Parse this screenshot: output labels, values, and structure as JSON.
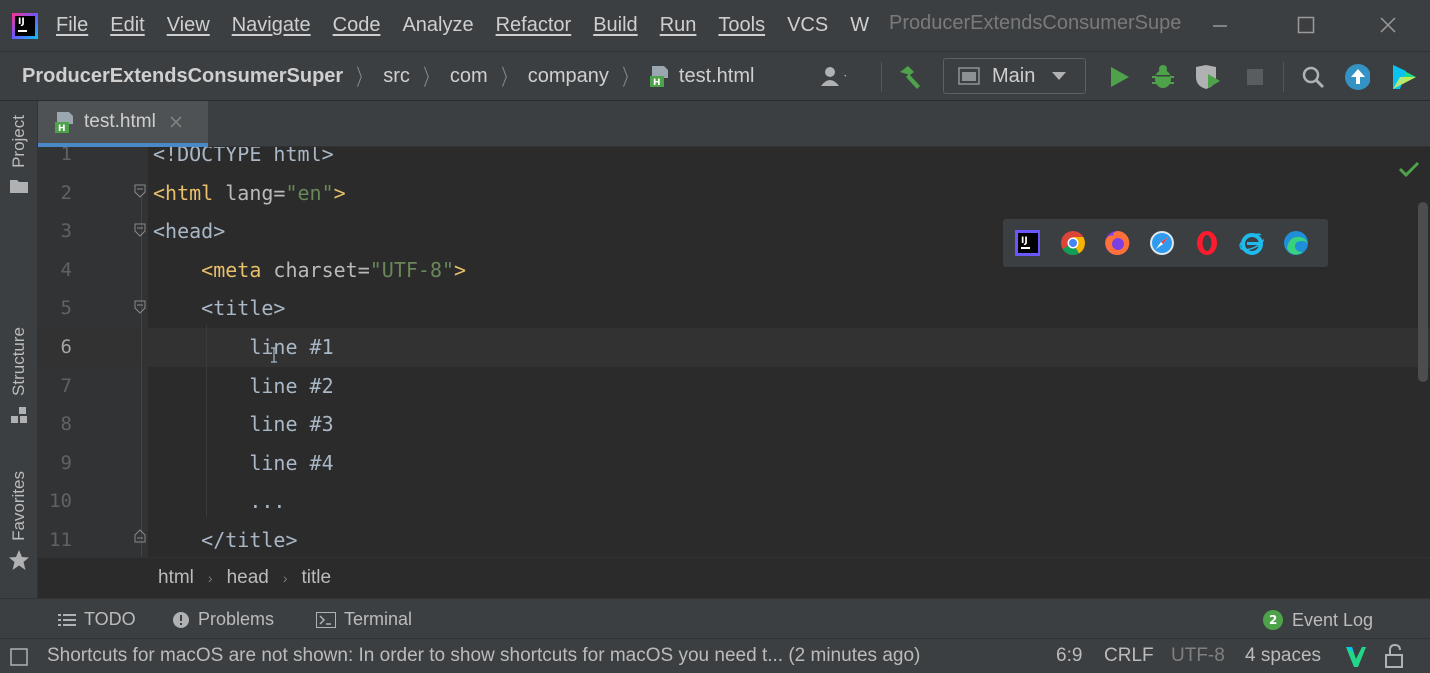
{
  "menu": {
    "app_logo_text": "IJ",
    "items": [
      "File",
      "Edit",
      "View",
      "Navigate",
      "Code",
      "Analyze",
      "Refactor",
      "Build",
      "Run",
      "Tools",
      "VCS",
      "W"
    ],
    "window_title": "ProducerExtendsConsumerSuper"
  },
  "navbar": {
    "crumbs": [
      "ProducerExtendsConsumerSuper",
      "src",
      "com",
      "company",
      "test.html"
    ],
    "run_config": "Main"
  },
  "left_strip": {
    "tabs": [
      "Project",
      "Structure",
      "Favorites"
    ]
  },
  "editor_tabs": [
    {
      "label": "test.html",
      "active": true
    }
  ],
  "editor": {
    "lines": [
      {
        "num": "1",
        "text": "<!DOCTYPE html>"
      },
      {
        "num": "2",
        "text": "<html lang=\"en\">"
      },
      {
        "num": "3",
        "text": "<head>"
      },
      {
        "num": "4",
        "text": "    <meta charset=\"UTF-8\">"
      },
      {
        "num": "5",
        "text": "    <title>"
      },
      {
        "num": "6",
        "text": "        line #1"
      },
      {
        "num": "7",
        "text": "        line #2"
      },
      {
        "num": "8",
        "text": "        line #3"
      },
      {
        "num": "9",
        "text": "        line #4"
      },
      {
        "num": "10",
        "text": "        ..."
      },
      {
        "num": "11",
        "text": "    </title>"
      }
    ],
    "browsers": [
      "intellij-icon",
      "chrome-icon",
      "firefox-icon",
      "safari-icon",
      "opera-icon",
      "ie-icon",
      "edge-icon"
    ]
  },
  "breadcrumb_bar": [
    "html",
    "head",
    "title"
  ],
  "tool_windows": {
    "todo": "TODO",
    "problems": "Problems",
    "terminal": "Terminal",
    "event_log": "Event Log",
    "event_count": "2"
  },
  "status": {
    "message": "Shortcuts for macOS are not shown: In order to show shortcuts for macOS you need t... (2 minutes ago)",
    "position": "6:9",
    "line_sep": "CRLF",
    "encoding": "UTF-8",
    "indent": "4 spaces"
  },
  "colors": {
    "accent": "#4a88c7",
    "tag": "#e8bf6a",
    "string": "#6a8759",
    "run_green": "#4ea34a"
  }
}
